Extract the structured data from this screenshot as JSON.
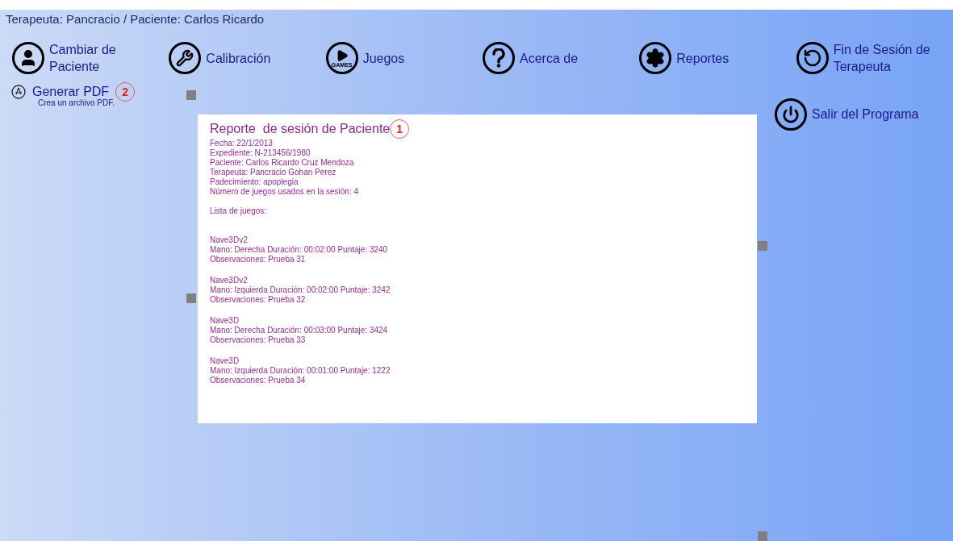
{
  "header": {
    "session_info": "Terapeuta: Pancracio / Paciente: Carlos Ricardo"
  },
  "toolbar": [
    {
      "kind": "person",
      "lines": [
        "Cambiar de",
        "Paciente"
      ]
    },
    {
      "kind": "wrench",
      "lines": [
        "Calibración"
      ]
    },
    {
      "kind": "games",
      "icon_text": "GAMES",
      "lines": [
        "Juegos"
      ]
    },
    {
      "kind": "help",
      "lines": [
        "Acerca de"
      ]
    },
    {
      "kind": "gear",
      "lines": [
        "Reportes"
      ]
    },
    {
      "kind": "restart",
      "lines": [
        "Fin de Sesión de",
        "Terapeuta"
      ]
    }
  ],
  "side_action": {
    "title": "Generar PDF",
    "subtitle": "Crea un archivo PDF.",
    "callout": "2"
  },
  "exit_button": {
    "label": "Salir del Programa"
  },
  "report": {
    "title": "Reporte  de sesión de Paciente",
    "callout": "1",
    "info": [
      "Fecha: 22/1/2013",
      "Expediente: N-213456/1980",
      "Paciente: Carlos Ricardo Cruz Mendoza",
      "Terapeuta: Pancracio Gohan Perez",
      "Padecimiento: apoplegia",
      "Número de juegos usados en la sesión: 4"
    ],
    "list_heading": "Lista de juegos:",
    "games": [
      {
        "name": "Nave3Dv2",
        "details": "Mano: Derecha Duración: 00:02:00 Puntaje: 3240",
        "observations": "Observaciones: Prueba 31"
      },
      {
        "name": "Nave3Dv2",
        "details": "Mano: Izquierda Duración: 00:02:00 Puntaje: 3242",
        "observations": "Observaciones: Prueba 32"
      },
      {
        "name": "Nave3D",
        "details": "Mano: Derecha Duración: 00:03:00 Puntaje: 3424",
        "observations": "Observaciones: Prueba 33"
      },
      {
        "name": "Nave3D",
        "details": "Mano: Izquierda Duración: 00:01:00 Puntaje: 1222",
        "observations": "Observaciones: Prueba 34"
      }
    ]
  }
}
